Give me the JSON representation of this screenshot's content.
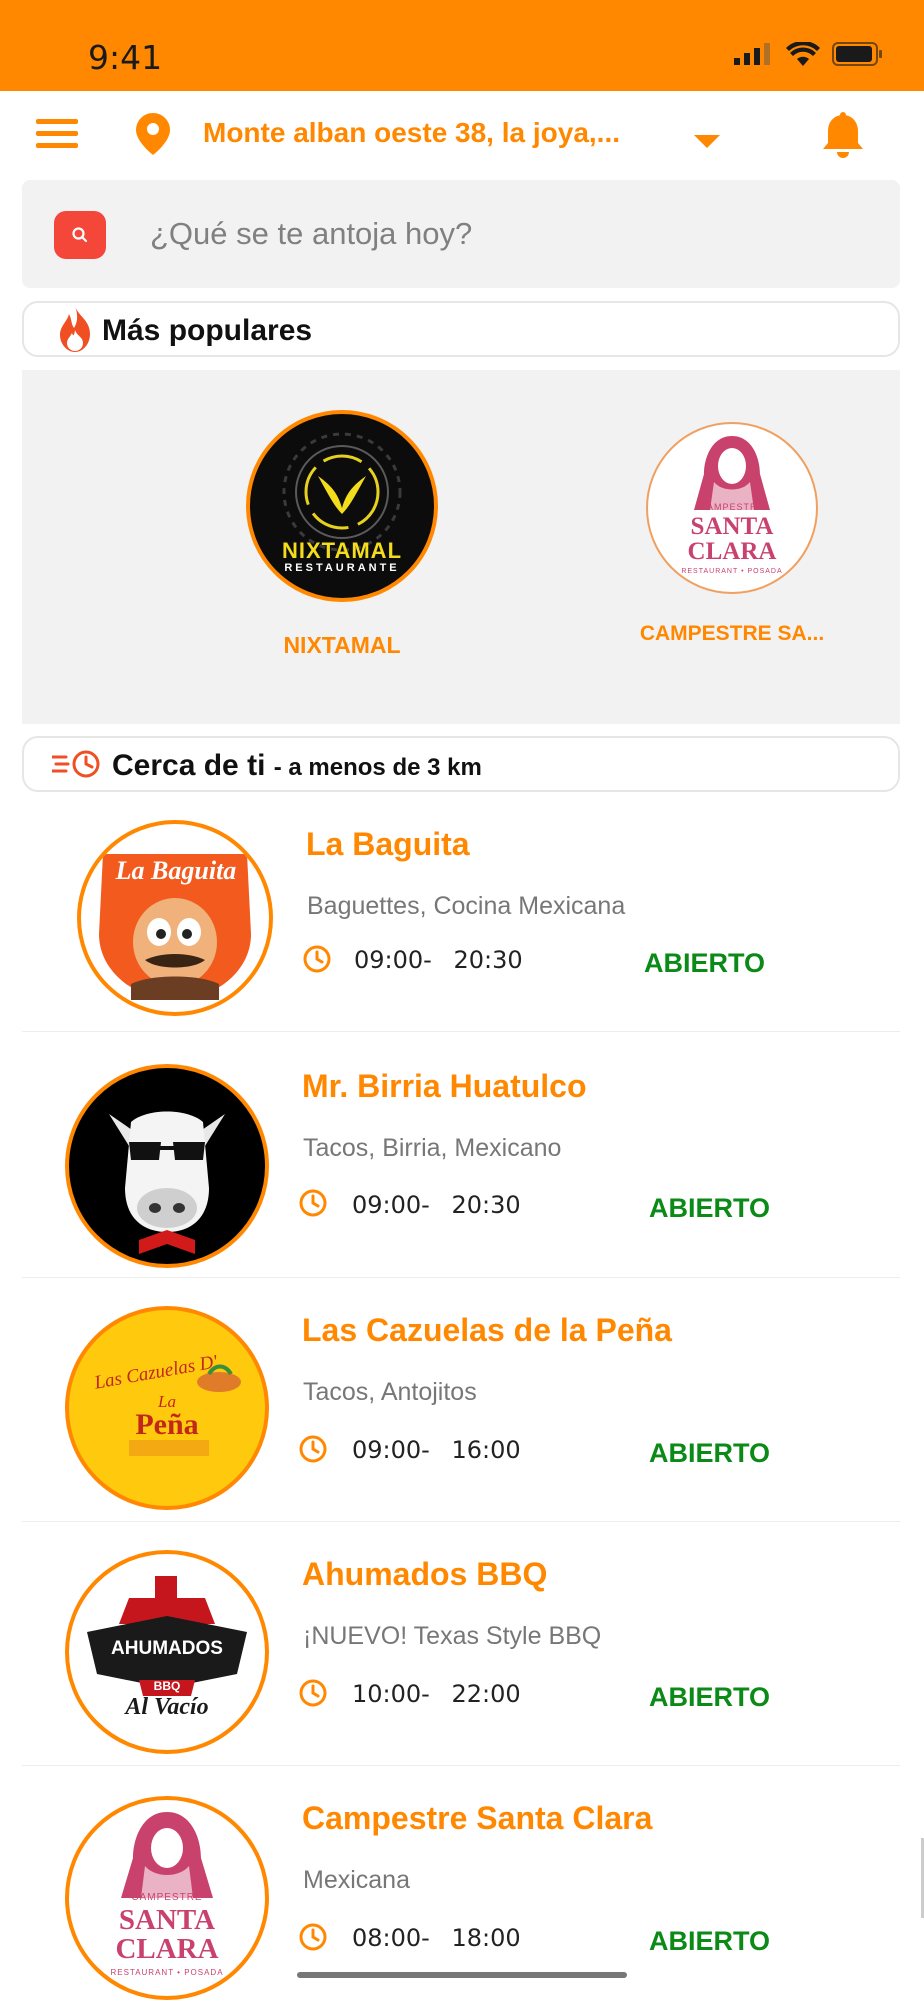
{
  "status_bar": {
    "time": "9:41"
  },
  "header": {
    "address": "Monte alban oeste 38, la joya,..."
  },
  "search": {
    "placeholder": "¿Qué se te antoja hoy?"
  },
  "popular": {
    "title": "Más populares",
    "items": [
      {
        "name": "NIXTAMAL",
        "logo_text": "NIXTAMAL",
        "logo_sub": "RESTAURANTE"
      },
      {
        "name": "CAMPESTRE SA...",
        "logo_top": "CAMPESTRE",
        "logo_text": "SANTA CLARA",
        "logo_sub": "RESTAURANT • POSADA"
      }
    ]
  },
  "nearby": {
    "title": "Cerca de ti",
    "subtitle": "- a menos de 3 km",
    "restaurants": [
      {
        "name": "La Baguita",
        "categories": "Baguettes, Cocina Mexicana",
        "open": "09:00-",
        "close": "20:30",
        "status": "ABIERTO",
        "logo_text": "La Baguita"
      },
      {
        "name": "Mr. Birria Huatulco",
        "categories": "Tacos, Birria, Mexicano",
        "open": "09:00-",
        "close": "20:30",
        "status": "ABIERTO"
      },
      {
        "name": "Las Cazuelas de la Peña",
        "categories": "Tacos, Antojitos",
        "open": "09:00-",
        "close": "16:00",
        "status": "ABIERTO",
        "logo_text": "Las Cazuelas D'",
        "logo_text2": "La",
        "logo_text3": "Peña"
      },
      {
        "name": "Ahumados BBQ",
        "categories": "¡NUEVO! Texas Style BBQ",
        "open": "10:00-",
        "close": "22:00",
        "status": "ABIERTO",
        "logo_text": "AHUMADOS",
        "logo_text2": "BBQ",
        "logo_text3": "Al Vacío"
      },
      {
        "name": "Campestre Santa Clara",
        "categories": "Mexicana",
        "open": "08:00-",
        "close": "18:00",
        "status": "ABIERTO",
        "logo_top": "CAMPESTRE",
        "logo_text": "SANTA CLARA",
        "logo_sub": "RESTAURANT • POSADA"
      }
    ]
  },
  "colors": {
    "accent": "#ff8800",
    "open_green": "#0b8a18",
    "search_red": "#f5463a"
  }
}
